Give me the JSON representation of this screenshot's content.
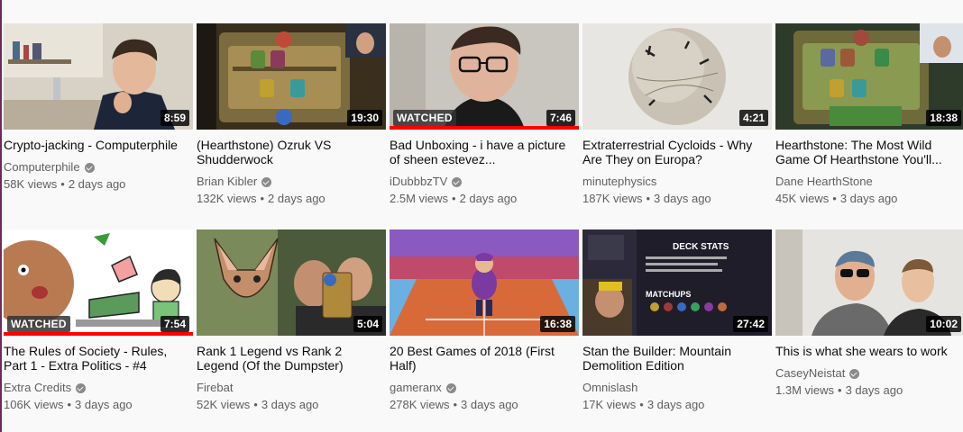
{
  "videos": [
    {
      "title": "Crypto-jacking - Computerphile",
      "channel": "Computerphile",
      "verified": true,
      "views": "58K views",
      "age": "2 days ago",
      "duration": "8:59",
      "watched": "",
      "progress": 0
    },
    {
      "title": "(Hearthstone) Ozruk VS Shudderwock",
      "channel": "Brian Kibler",
      "verified": true,
      "views": "132K views",
      "age": "2 days ago",
      "duration": "19:30",
      "watched": "",
      "progress": 0
    },
    {
      "title": "Bad Unboxing - i have a picture of sheen estevez...",
      "channel": "iDubbbzTV",
      "verified": true,
      "views": "2.5M views",
      "age": "2 days ago",
      "duration": "7:46",
      "watched": "WATCHED",
      "progress": 1.0
    },
    {
      "title": "Extraterrestrial Cycloids - Why Are They on Europa?",
      "channel": "minutephysics",
      "verified": false,
      "views": "187K views",
      "age": "3 days ago",
      "duration": "4:21",
      "watched": "",
      "progress": 0
    },
    {
      "title": "Hearthstone: The Most Wild Game Of Hearthstone You'll...",
      "channel": "Dane HearthStone",
      "verified": false,
      "views": "45K views",
      "age": "3 days ago",
      "duration": "18:38",
      "watched": "",
      "progress": 0
    },
    {
      "title": "The Rules of Society - Rules, Part 1 - Extra Politics - #4",
      "channel": "Extra Credits",
      "verified": true,
      "views": "106K views",
      "age": "3 days ago",
      "duration": "7:54",
      "watched": "WATCHED",
      "progress": 1.0
    },
    {
      "title": "Rank 1 Legend vs Rank 2 Legend (Of the Dumpster)",
      "channel": "Firebat",
      "verified": false,
      "views": "52K views",
      "age": "3 days ago",
      "duration": "5:04",
      "watched": "",
      "progress": 0
    },
    {
      "title": "20 Best Games of 2018 (First Half)",
      "channel": "gameranx",
      "verified": true,
      "views": "278K views",
      "age": "3 days ago",
      "duration": "16:38",
      "watched": "",
      "progress": 0
    },
    {
      "title": "Stan the Builder: Mountain Demolition Edition",
      "channel": "Omnislash",
      "verified": false,
      "views": "17K views",
      "age": "3 days ago",
      "duration": "27:42",
      "watched": "",
      "progress": 0
    },
    {
      "title": "This is what she wears to work",
      "channel": "CaseyNeistat",
      "verified": true,
      "views": "1.3M views",
      "age": "3 days ago",
      "duration": "10:02",
      "watched": "",
      "progress": 0
    }
  ],
  "meta_separator": "•",
  "thumbnail_art": {
    "card-thumb-1": "office-man",
    "card-thumb-2": "hearthstone-board",
    "card-thumb-3": "man-glasses",
    "card-thumb-4": "europa-moon",
    "card-thumb-5": "hearthstone-board-cam",
    "card-thumb-6": "cartoon-characters",
    "card-thumb-7": "cartoon-bat-crowd",
    "card-thumb-8": "tennis-game",
    "card-thumb-9": "deck-stats",
    "card-thumb-10": "two-men-sunglasses"
  }
}
